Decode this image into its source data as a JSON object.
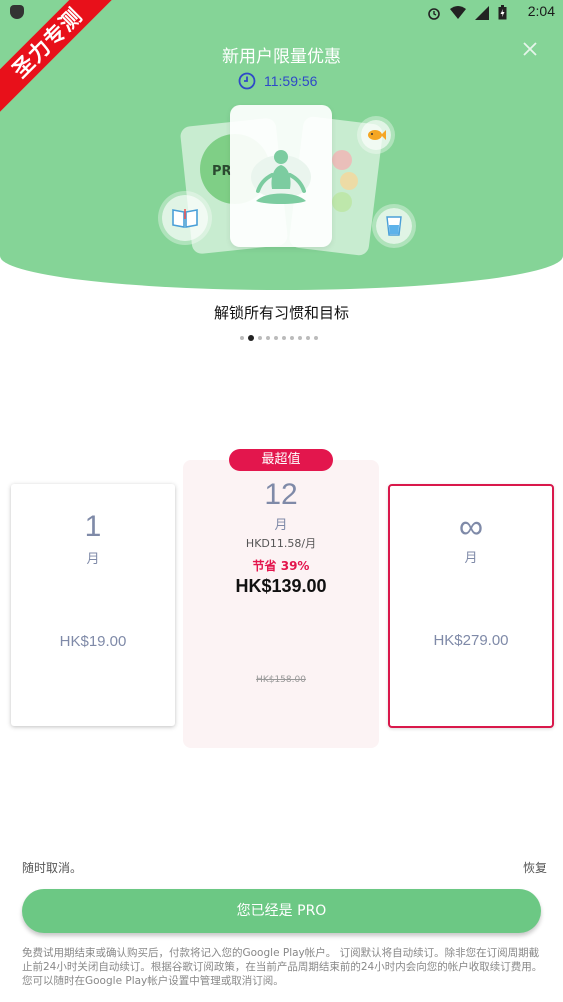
{
  "status_bar": {
    "time": "2:04"
  },
  "promo_ribbon": {
    "text": "圣力专测"
  },
  "hero": {
    "title": "新用户限量优惠",
    "countdown": "11:59:56",
    "card_label": "PR"
  },
  "feature": {
    "subtitle": "解锁所有习惯和目标",
    "dots_total": 10,
    "dots_active_index": 1
  },
  "plans": {
    "badge": "最超值",
    "monthly": {
      "number": "1",
      "unit": "月",
      "price": "HK$19.00"
    },
    "yearly": {
      "number": "12",
      "unit": "月",
      "per_month": "HKD11.58/月",
      "save": "节省 39%",
      "price": "HK$139.00",
      "original_price": "HK$158.00"
    },
    "lifetime": {
      "number": "∞",
      "unit": "月",
      "price": "HK$279.00"
    }
  },
  "footer": {
    "cancel_anytime": "随时取消。",
    "restore": "恢复",
    "cta": "您已经是 PRO",
    "legal": "免费试用期结束或确认购买后，付款将记入您的Google Play帐户。 订阅默认将自动续订。除非您在订阅周期截止前24小时关闭自动续订。根据谷歌订阅政策，在当前产品周期结束前的24小时内会向您的帐户收取续订费用。 您可以随时在Google Play帐户设置中管理或取消订阅。"
  },
  "colors": {
    "hero_green": "#85d497",
    "cta_green": "#6cc884",
    "accent_red": "#e3164d",
    "muted_blue": "#7f8aa8"
  }
}
